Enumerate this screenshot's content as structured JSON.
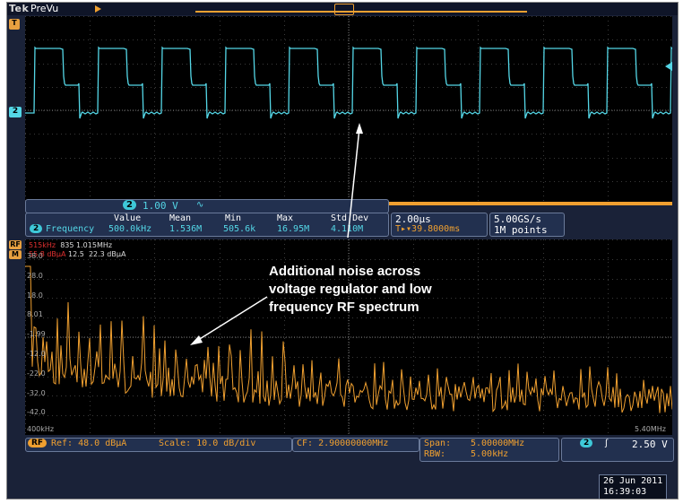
{
  "header": {
    "brand": "Tek",
    "mode": "PreVu"
  },
  "markers": {
    "channel_marker": "2",
    "trigger_marker": "T",
    "rf_marker": "RF",
    "ref_marker": "M",
    "t_badge": "T"
  },
  "time_panel": {
    "channel_scale": {
      "badge": "2",
      "value": "1.00 V",
      "coupling": "∿"
    },
    "measurements": {
      "headers": [
        "Value",
        "Mean",
        "Min",
        "Max",
        "Std Dev"
      ],
      "label_badge": "2",
      "label": "Frequency",
      "values": [
        "500.0kHz",
        "1.536M",
        "505.6k",
        "16.95M",
        "4.110M"
      ]
    },
    "horizontal": {
      "scale": "2.00µs",
      "trigger_pos": "T▸▾39.8000ms"
    },
    "acquisition": {
      "rate": "5.00GS/s",
      "length": "1M points"
    }
  },
  "spectrum_panel": {
    "marker_line1": {
      "ref": "515kHz",
      "delta_label": "835",
      "delta": "1.015MHz"
    },
    "marker_line2": {
      "ref": "55.8 dBµA",
      "delta_label": "12.5",
      "delta": "22.3 dBµA"
    },
    "y_ticks": [
      "38.0",
      "28.0",
      "18.0",
      "8.01",
      "-1.99",
      "-12.0",
      "-22.0",
      "-32.0",
      "-42.0"
    ],
    "x_start": "400kHz",
    "x_end": "5.40MHz"
  },
  "status_bar": {
    "rf_badge": "RF",
    "ref": "Ref: 48.0 dBµA",
    "scale": "Scale: 10.0 dB/div",
    "cf": "CF: 2.90000000MHz",
    "span": "Span:",
    "span_value": "5.00000MHz",
    "rbw": "RBW:",
    "rbw_value": "5.00kHz",
    "trig_badge": "2",
    "trig_slope": "ʃ",
    "trig_level": "2.50 V"
  },
  "datetime": {
    "date": "26 Jun 2011",
    "time": "16:39:03"
  },
  "annotation": {
    "lines": [
      "Additional noise across",
      "voltage regulator and low",
      "frequency RF spectrum"
    ]
  },
  "colors": {
    "trace_time": "#54d6e6",
    "trace_spectrum": "#f0a030",
    "background": "#1a2238"
  }
}
